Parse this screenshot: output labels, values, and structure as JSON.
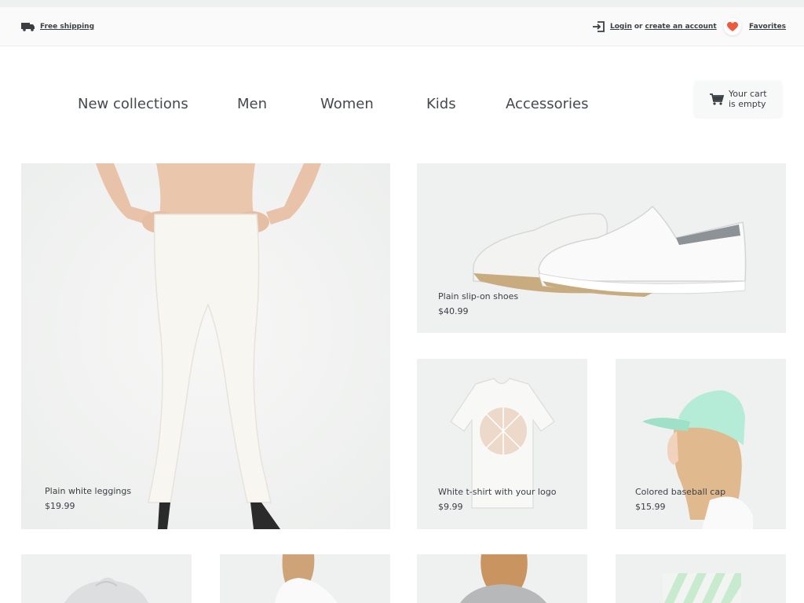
{
  "topbar": {
    "shipping_label": "Free shipping",
    "login_label": "Login",
    "or_label": "or",
    "create_label": "create an account",
    "favorites_label": "Favorites"
  },
  "nav": {
    "items": [
      {
        "label": "New collections"
      },
      {
        "label": "Men"
      },
      {
        "label": "Women"
      },
      {
        "label": "Kids"
      },
      {
        "label": "Accessories"
      }
    ]
  },
  "cart": {
    "line1": "Your cart",
    "line2": "is empty"
  },
  "products": [
    {
      "name": "Plain white leggings",
      "price": "$19.99"
    },
    {
      "name": "Plain slip-on shoes",
      "price": "$40.99"
    },
    {
      "name": "White t-shirt with your logo",
      "price": "$9.99"
    },
    {
      "name": "Colored baseball cap",
      "price": "$15.99"
    }
  ],
  "icons": {
    "truck": "truck-icon",
    "login": "login-icon",
    "heart": "heart-icon",
    "cart": "cart-icon"
  },
  "colors": {
    "accent": "#f05a3c",
    "text": "#3a3f44",
    "tile_bg": "#eff0f0"
  }
}
